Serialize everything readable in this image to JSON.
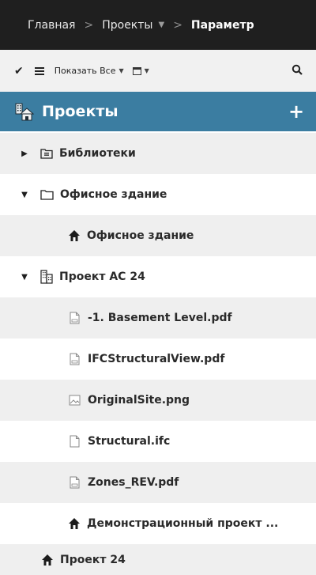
{
  "breadcrumb": {
    "home": "Главная",
    "projects": "Проекты",
    "current": "Параметр"
  },
  "toolbar": {
    "show_all": "Показать Все"
  },
  "section": {
    "title": "Проекты"
  },
  "tree": [
    {
      "label": "Библиотеки",
      "icon": "library-icon",
      "expand": "collapsed"
    },
    {
      "label": "Офисное здание",
      "icon": "folder-icon",
      "expand": "expanded"
    },
    {
      "label": "Офисное здание",
      "icon": "house-icon"
    },
    {
      "label": "Проект АС 24",
      "icon": "building-icon",
      "expand": "expanded"
    },
    {
      "label": "-1. Basement Level.pdf",
      "icon": "pdf-file-icon"
    },
    {
      "label": "IFCStructuralView.pdf",
      "icon": "pdf-file-icon"
    },
    {
      "label": "OriginalSite.png",
      "icon": "image-file-icon"
    },
    {
      "label": "Structural.ifc",
      "icon": "file-icon"
    },
    {
      "label": "Zones_REV.pdf",
      "icon": "pdf-file-icon"
    },
    {
      "label": "Демонстрационный проект ...",
      "icon": "house-icon"
    },
    {
      "label": "Проект 24",
      "icon": "house-icon"
    }
  ],
  "colors": {
    "breadcrumb_bg": "#1f1f1f",
    "header_bg": "#3b7da1",
    "row_alt_bg": "#efefef"
  }
}
